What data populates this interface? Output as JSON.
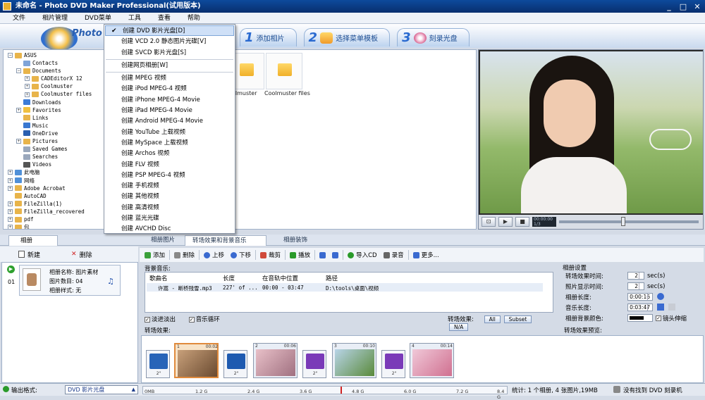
{
  "window": {
    "title": "未命名 - Photo DVD Maker Professional(试用版本)",
    "min": "_",
    "max": "□",
    "close": "✕"
  },
  "menubar": [
    "文件",
    "相片管理",
    "DVD菜单",
    "工具",
    "查看",
    "帮助"
  ],
  "logo": {
    "word": "Photo"
  },
  "steps": [
    {
      "num": "1",
      "label": "添加相片"
    },
    {
      "num": "2",
      "label": "选择菜单模板"
    },
    {
      "num": "3",
      "label": "刻录光盘"
    }
  ],
  "dropdown": [
    {
      "label": "创建 DVD 影片光盘[D]",
      "checked": true
    },
    {
      "label": "创建 VCD 2.0 静态图片光碟[V]"
    },
    {
      "label": "创建 SVCD 影片光盘[S]"
    },
    {
      "label": "创建网页相册[W]"
    },
    {
      "label": "创建 MPEG 视频"
    },
    {
      "label": "创建 iPod MPEG-4 视频"
    },
    {
      "label": "创建 iPhone MPEG-4 Movie"
    },
    {
      "label": "创建 iPad MPEG-4 Movie"
    },
    {
      "label": "创建 Android MPEG-4 Movie"
    },
    {
      "label": "创建 YouTube 上载视频"
    },
    {
      "label": "创建 MySpace 上载视频"
    },
    {
      "label": "创建 Archos 视频"
    },
    {
      "label": "创建 FLV 视频"
    },
    {
      "label": "创建 PSP MPEG-4 视频"
    },
    {
      "label": "创建 手机视频"
    },
    {
      "label": "创建 其他视频"
    },
    {
      "label": "创建 高清视频"
    },
    {
      "label": "创建 蓝光光碟"
    },
    {
      "label": "创建 AVCHD Disc"
    }
  ],
  "tree": [
    {
      "label": "ASUS",
      "depth": 1,
      "exp": "-",
      "color": "#e8b44a"
    },
    {
      "label": "Contacts",
      "depth": 2,
      "exp": "",
      "color": "#7fa4d8"
    },
    {
      "label": "Documents",
      "depth": 2,
      "exp": "-",
      "color": "#e8b44a"
    },
    {
      "label": "CADEditorX 12",
      "depth": 3,
      "exp": "+",
      "color": "#e8b44a"
    },
    {
      "label": "Coolmuster",
      "depth": 3,
      "exp": "+",
      "color": "#e8b44a"
    },
    {
      "label": "Coolmuster files",
      "depth": 3,
      "exp": "+",
      "color": "#e8b44a"
    },
    {
      "label": "Downloads",
      "depth": 2,
      "exp": "",
      "color": "#3c7cd8"
    },
    {
      "label": "Favorites",
      "depth": 2,
      "exp": "+",
      "color": "#f0c040"
    },
    {
      "label": "Links",
      "depth": 2,
      "exp": "",
      "color": "#e8b44a"
    },
    {
      "label": "Music",
      "depth": 2,
      "exp": "",
      "color": "#3a78d0"
    },
    {
      "label": "OneDrive",
      "depth": 2,
      "exp": "",
      "color": "#2a5fb0"
    },
    {
      "label": "Pictures",
      "depth": 2,
      "exp": "+",
      "color": "#e8b44a"
    },
    {
      "label": "Saved Games",
      "depth": 2,
      "exp": "",
      "color": "#9aa8bc"
    },
    {
      "label": "Searches",
      "depth": 2,
      "exp": "",
      "color": "#9aa8bc"
    },
    {
      "label": "Videos",
      "depth": 2,
      "exp": "",
      "color": "#555"
    },
    {
      "label": "此电脑",
      "depth": 1,
      "exp": "+",
      "color": "#5090d8"
    },
    {
      "label": "网络",
      "depth": 1,
      "exp": "+",
      "color": "#5090d8"
    },
    {
      "label": "Adobe Acrobat",
      "depth": 1,
      "exp": "+",
      "color": "#e8b44a"
    },
    {
      "label": "AutoCAD",
      "depth": 1,
      "exp": "",
      "color": "#e8b44a"
    },
    {
      "label": "FileZilla(1)",
      "depth": 1,
      "exp": "+",
      "color": "#e8b44a"
    },
    {
      "label": "FileZilla_recovered",
      "depth": 1,
      "exp": "+",
      "color": "#e8b44a"
    },
    {
      "label": "pdf",
      "depth": 1,
      "exp": "+",
      "color": "#e8b44a"
    },
    {
      "label": "包",
      "depth": 1,
      "exp": "+",
      "color": "#e8b44a"
    }
  ],
  "files": [
    {
      "label": "olmuster"
    },
    {
      "label": "Coolmuster files"
    }
  ],
  "player": {
    "time": "00:00:00",
    "sub": "1/3"
  },
  "album_panel": {
    "tab": "相册",
    "new": "新建",
    "delete": "删除",
    "index": "01",
    "name_label": "相册名称:",
    "name_value": "图片素材",
    "count_label": "图片数目:",
    "count_value": "04",
    "style_label": "相册样式:",
    "style_value": "无"
  },
  "main_tabs": [
    "相册图片",
    "转场效果和背景音乐",
    "相册装饰"
  ],
  "toolbar": [
    "添加",
    "删除",
    "上移",
    "下移",
    "裁剪",
    "播放",
    "",
    "",
    "导入CD",
    "录音",
    "更多..."
  ],
  "music": {
    "section_label": "背景音乐:",
    "headers": [
      "歌曲名",
      "长度",
      "在音轨中位置",
      "路径"
    ],
    "row": [
      "许嵩 - 断桥残雪.mp3",
      "227' of ...",
      "00:00 - 03:47",
      "D:\\tools\\桌面\\视频"
    ]
  },
  "options": {
    "fade": "淡进淡出",
    "loop": "音乐循环",
    "trans_label": "转场效果:",
    "btn_all": "All",
    "btn_subset": "Subset",
    "btn_na": "N/A"
  },
  "settings": {
    "title": "相册设置",
    "trans_time_label": "转场效果时间:",
    "trans_time": "2",
    "sec1": "sec(s)",
    "photo_time_label": "照片显示时间:",
    "photo_time": "2",
    "sec2": "sec(s)",
    "album_len_label": "相册长度:",
    "album_len": "0:00:16",
    "music_len_label": "音乐长度:",
    "music_len": "0:03:47",
    "bg_color_label": "相册背景颜色:",
    "zoom": "镜头伸缩"
  },
  "trans_section": "转场效果:",
  "trans_preview": "转场效果预览:",
  "clips": [
    {
      "idx": "1",
      "time": "00:02"
    },
    {
      "idx": "2",
      "time": "00:06"
    },
    {
      "idx": "3",
      "time": "00:10"
    },
    {
      "idx": "4",
      "time": "00:14"
    }
  ],
  "transitions": [
    "2\"",
    "2\"",
    "2\"",
    "2\""
  ],
  "status": {
    "fmt_label": "输出格式:",
    "fmt_value": "DVD 影片光盘",
    "ticks": [
      "0MB",
      "1.2 G",
      "2.4 G",
      "3.6 G",
      "4.8 G",
      "6.0 G",
      "7.2 G",
      "8.4 G"
    ],
    "summary": "统计: 1 个相册, 4 张图片,19MB",
    "burner": "没有找到 DVD 刻录机"
  }
}
